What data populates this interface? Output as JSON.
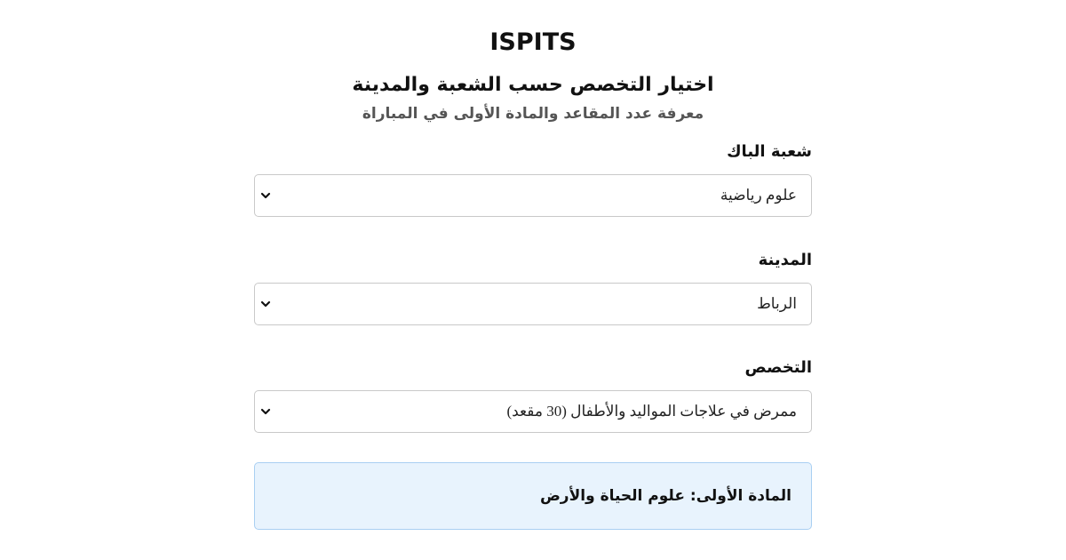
{
  "header": {
    "site_title": "ISPITS",
    "heading": "اختيار التخصص حسب الشعبة والمدينة",
    "subheading": "معرفة عدد المقاعد والمادة الأولى في المباراة"
  },
  "form": {
    "branch": {
      "label": "شعبة الباك",
      "selected": "علوم رياضية"
    },
    "city": {
      "label": "المدينة",
      "selected": "الرباط"
    },
    "specialty": {
      "label": "التخصص",
      "selected": "ممرض في علاجات المواليد والأطفال (30 مقعد)"
    }
  },
  "result": {
    "text": "المادة الأولى: علوم الحياة والأرض"
  },
  "colors": {
    "result_background": "#e8f3fd",
    "result_border": "#a9cff2",
    "subheading_text": "#555555"
  }
}
